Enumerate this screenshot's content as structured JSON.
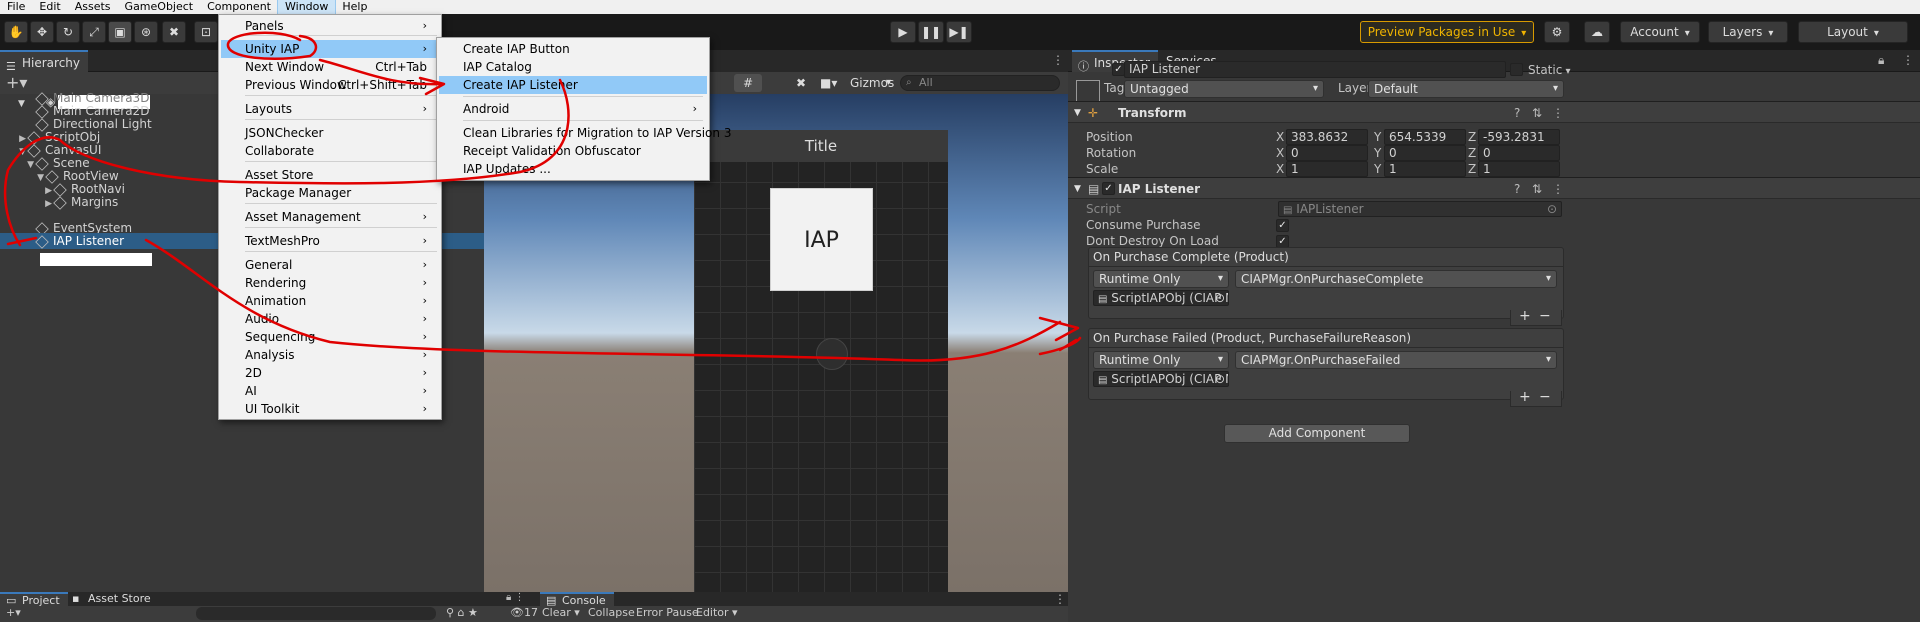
{
  "menubar": {
    "items": [
      "File",
      "Edit",
      "Assets",
      "GameObject",
      "Component",
      "Window",
      "Help"
    ],
    "active": "Window"
  },
  "toolbar": {
    "preview_packages": "Preview Packages in Use",
    "account": "Account",
    "layers": "Layers",
    "layout": "Layout",
    "play_icon": "play-icon",
    "pause_icon": "pause-icon",
    "step_icon": "step-icon"
  },
  "hierarchy": {
    "tab": "Hierarchy",
    "rows": [
      {
        "label": "Main Camera3D",
        "dim": true
      },
      {
        "label": "Main Camera2D"
      },
      {
        "label": "Directional Light"
      },
      {
        "label": "ScriptObj"
      },
      {
        "label": "CanvasUI"
      },
      {
        "label": "Scene"
      },
      {
        "label": "RootView"
      },
      {
        "label": "RootNavi"
      },
      {
        "label": "Margins"
      },
      {
        "label": "EventSystem"
      },
      {
        "label": "IAP Listener",
        "selected": true
      }
    ]
  },
  "scene": {
    "gizmos": "Gizmos",
    "search_placeholder": "All",
    "title_text": "Title",
    "iap_button_text": "IAP"
  },
  "window_menu": {
    "items": [
      {
        "label": "Panels",
        "sub": true
      },
      {
        "label": "Unity IAP",
        "sub": true,
        "highlight": true
      },
      {
        "label": "Next Window",
        "shortcut": "Ctrl+Tab"
      },
      {
        "label": "Previous Window",
        "shortcut": "Ctrl+Shift+Tab"
      },
      {
        "label": "Layouts",
        "sub": true
      },
      {
        "label": "JSONChecker"
      },
      {
        "label": "Collaborate"
      },
      {
        "label": "Asset Store"
      },
      {
        "label": "Package Manager"
      },
      {
        "label": "Asset Management",
        "sub": true
      },
      {
        "label": "TextMeshPro",
        "sub": true
      },
      {
        "label": "General",
        "sub": true
      },
      {
        "label": "Rendering",
        "sub": true
      },
      {
        "label": "Animation",
        "sub": true
      },
      {
        "label": "Audio",
        "sub": true
      },
      {
        "label": "Sequencing",
        "sub": true
      },
      {
        "label": "Analysis",
        "sub": true
      },
      {
        "label": "2D",
        "sub": true
      },
      {
        "label": "AI",
        "sub": true
      },
      {
        "label": "UI Toolkit",
        "sub": true
      }
    ]
  },
  "iap_menu": {
    "items": [
      {
        "label": "Create IAP Button"
      },
      {
        "label": "IAP Catalog"
      },
      {
        "label": "Create IAP Listener",
        "highlight": true
      },
      {
        "label": "Android",
        "sub": true
      },
      {
        "label": "Clean Libraries for Migration to IAP Version 3"
      },
      {
        "label": "Receipt Validation Obfuscator"
      },
      {
        "label": "IAP Updates ..."
      }
    ]
  },
  "inspector": {
    "tab_inspector": "Inspector",
    "tab_services": "Services",
    "object_name": "IAP Listener",
    "static_label": "Static",
    "tag_label": "Tag",
    "tag_value": "Untagged",
    "layer_label": "Layer",
    "layer_value": "Default",
    "transform": {
      "title": "Transform",
      "position_label": "Position",
      "rotation_label": "Rotation",
      "scale_label": "Scale",
      "position": {
        "x": "383.8632",
        "y": "654.5339",
        "z": "-593.2831"
      },
      "rotation": {
        "x": "0",
        "y": "0",
        "z": "0"
      },
      "scale": {
        "x": "1",
        "y": "1",
        "z": "1"
      },
      "axis_x": "X",
      "axis_y": "Y",
      "axis_z": "Z"
    },
    "component": {
      "title": "IAP Listener",
      "script_label": "Script",
      "script_value": "IAPListener",
      "consume_label": "Consume Purchase",
      "dontdestroy_label": "Dont Destroy On Load",
      "check_mark": "✓"
    },
    "event_complete": {
      "title": "On Purchase Complete (Product)",
      "mode": "Runtime Only",
      "function": "CIAPMgr.OnPurchaseComplete",
      "target": "ScriptIAPObj (CIAP Mgr)"
    },
    "event_failed": {
      "title": "On Purchase Failed (Product, PurchaseFailureReason)",
      "mode": "Runtime Only",
      "function": "CIAPMgr.OnPurchaseFailed",
      "target": "ScriptIAPObj (CIAP Mgr)"
    },
    "add_component": "Add Component",
    "plus": "+",
    "minus": "−"
  },
  "bottom": {
    "project_tab": "Project",
    "asset_store_tab": "Asset Store",
    "console_tab": "Console",
    "clear": "Clear",
    "collapse": "Collapse",
    "error_pause": "Error Pause",
    "editor": "Editor",
    "count": "17"
  },
  "annotation_color": "#e00000"
}
